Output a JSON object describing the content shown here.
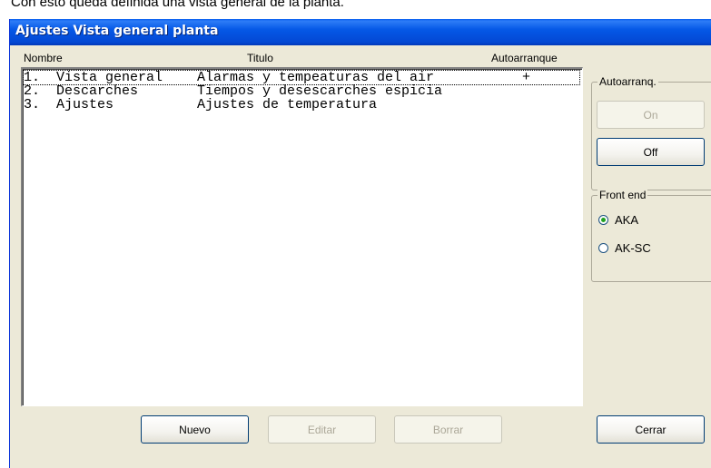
{
  "caption": "Con esto queda definida una vista general de la planta.",
  "window": {
    "title": "Ajustes Vista general planta"
  },
  "columns": {
    "nombre": "Nombre",
    "titulo": "Titulo",
    "autoarranque": "Autoarranque"
  },
  "rows": [
    {
      "num": "1.",
      "nombre": "Vista general",
      "titulo": "Alarmas y tempeaturas del air",
      "auto": "+"
    },
    {
      "num": "2.",
      "nombre": "Descarches",
      "titulo": "Tiempos y desescarches espicia",
      "auto": ""
    },
    {
      "num": "3.",
      "nombre": "Ajustes",
      "titulo": "Ajustes de temperatura",
      "auto": ""
    }
  ],
  "autoarranq": {
    "label": "Autoarranq.",
    "on": "On",
    "off": "Off"
  },
  "frontend": {
    "label": "Front end",
    "options": [
      "AKA",
      "AK-SC"
    ],
    "selected": "AKA"
  },
  "buttons": {
    "nuevo": "Nuevo",
    "editar": "Editar",
    "borrar": "Borrar",
    "cerrar": "Cerrar"
  }
}
